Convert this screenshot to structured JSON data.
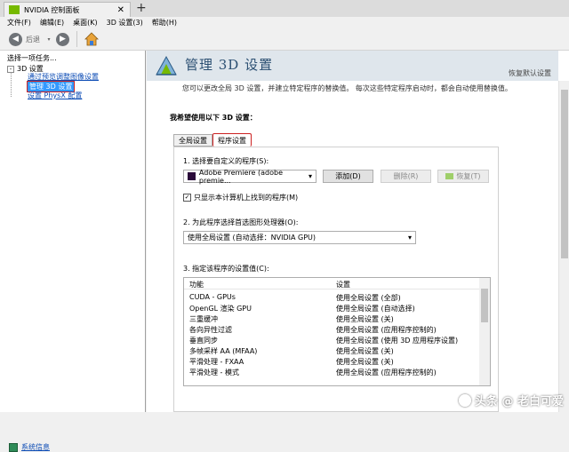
{
  "window": {
    "tab_title": "NVIDIA 控制面板",
    "tab_close": "✕",
    "new_tab": "+"
  },
  "menu": [
    "文件(F)",
    "编辑(E)",
    "桌面(K)",
    "3D 设置(3)",
    "帮助(H)"
  ],
  "toolbar": {
    "back_label": "后退"
  },
  "sidebar": {
    "header": "选择一项任务...",
    "root": {
      "label": "3D 设置",
      "expander": "-"
    },
    "items": [
      {
        "label": "通过预览调整图像设置"
      },
      {
        "label": "管理 3D 设置",
        "selected": true
      },
      {
        "label": "设置 PhysX 配置"
      }
    ],
    "system_info": "系统信息"
  },
  "banner": {
    "title": "管理 3D 设置",
    "restore": "恢复默认设置"
  },
  "description": "您可以更改全局 3D 设置，并建立特定程序的替换值。 每次这些特定程序启动时，都会自动使用替换值。",
  "section_header": "我希望使用以下 3D 设置：",
  "tabs": [
    {
      "label": "全局设置",
      "active": false
    },
    {
      "label": "程序设置",
      "active": true
    }
  ],
  "program": {
    "step1_label": "1. 选择要自定义的程序(S):",
    "selected_program": "Adobe Premiere (adobe premie...",
    "add_button": "添加(D)",
    "remove_button": "删除(R)",
    "restore_button": "恢复(T)",
    "show_only_label": "只显示本计算机上找到的程序(M)",
    "show_only_checked": true,
    "step2_label": "2. 为此程序选择首选图形处理器(O):",
    "gpu_selected": "使用全局设置 (自动选择：NVIDIA GPU)",
    "step3_label": "3. 指定该程序的设置值(C):"
  },
  "settings_table": {
    "columns": [
      "功能",
      "设置"
    ],
    "rows": [
      [
        "CUDA - GPUs",
        "使用全局设置 (全部)"
      ],
      [
        "OpenGL 渲染 GPU",
        "使用全局设置 (自动选择)"
      ],
      [
        "三重缓冲",
        "使用全局设置 (关)"
      ],
      [
        "各向异性过滤",
        "使用全局设置 (应用程序控制的)"
      ],
      [
        "垂直同步",
        "使用全局设置 (使用 3D 应用程序设置)"
      ],
      [
        "多帧采样 AA (MFAA)",
        "使用全局设置 (关)"
      ],
      [
        "平滑处理 - FXAA",
        "使用全局设置 (关)"
      ],
      [
        "平滑处理 - 模式",
        "使用全局设置 (应用程序控制的)"
      ]
    ]
  },
  "watermark": "头条 @ 老白可爱",
  "colors": {
    "nvidia_green": "#76b900",
    "banner_bg": "#dfe6ec",
    "link": "#0b4bb5",
    "selection": "#3399ff"
  }
}
